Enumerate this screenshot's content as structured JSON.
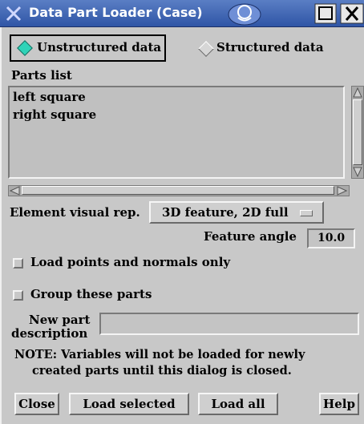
{
  "window": {
    "title": "Data Part Loader (Case)"
  },
  "source": {
    "unstructured_label": "Unstructured data",
    "structured_label": "Structured data",
    "selected": "Unstructured data"
  },
  "parts": {
    "heading": "Parts list",
    "items": [
      "left square",
      "right square"
    ]
  },
  "visual_rep": {
    "label": "Element visual rep.",
    "value": "3D feature, 2D full"
  },
  "feature_angle": {
    "label": "Feature angle",
    "value": "10.0"
  },
  "options": {
    "load_points_label": "Load points and normals only",
    "load_points_checked": false,
    "group_label": "Group these parts",
    "group_checked": false
  },
  "new_part": {
    "label_line1": "New part",
    "label_line2": "description",
    "value": ""
  },
  "note": {
    "line1": "NOTE: Variables will not be loaded for newly",
    "line2": "created parts until this dialog is closed."
  },
  "buttons": {
    "close": "Close",
    "load_selected": "Load selected",
    "load_all": "Load all",
    "help": "Help"
  },
  "colors": {
    "titlebar": "#2f55a6",
    "radio_on": "#2ed3b8",
    "background": "#c8c8c8"
  }
}
